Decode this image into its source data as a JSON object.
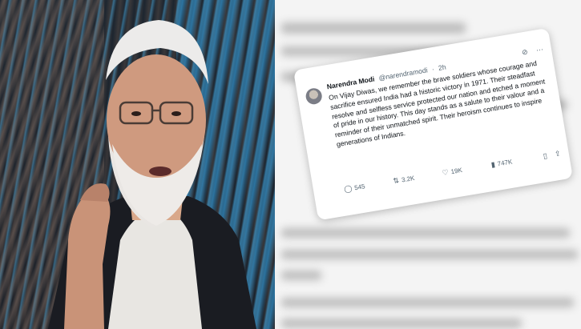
{
  "tweet": {
    "name": "Narendra Modi",
    "handle": "@narendramodi",
    "separator": "·",
    "time": "2h",
    "body": "On Vijay Diwas, we remember the brave soldiers whose courage and sacrifice ensured India had a historic victory in 1971. Their steadfast resolve and selfless service protected our nation and etched a moment of pride in our history. This day stands as a salute to their valour and a reminder of their unmatched spirit. Their heroism continues to inspire generations of Indians.",
    "replies": "545",
    "reposts": "3.2K",
    "likes": "19K",
    "views": "747K",
    "icons": {
      "grok": "grok-icon",
      "more": "more-icon",
      "reply": "reply-icon",
      "repost": "repost-icon",
      "like": "heart-icon",
      "views": "views-icon",
      "bookmark": "bookmark-icon",
      "share": "share-icon"
    }
  },
  "colors": {
    "text": "#0f1419",
    "muted": "#536471",
    "card": "#ffffff",
    "photo_blue": "#3c9bd2"
  }
}
